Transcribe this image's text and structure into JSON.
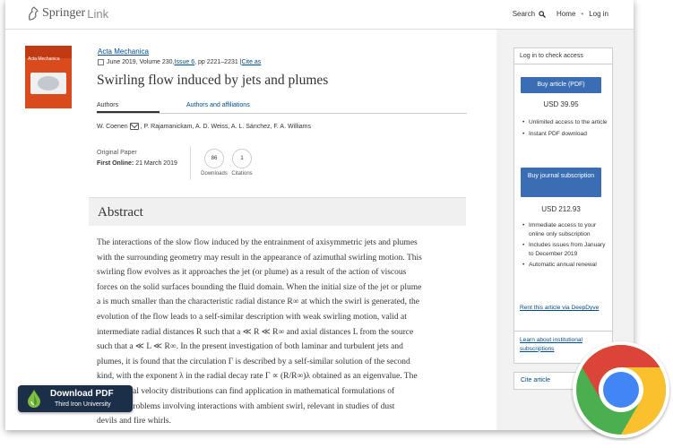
{
  "header": {
    "brand": "Springer",
    "brand_suffix": "Link",
    "search_label": "Search",
    "home_label": "Home",
    "separator": "•",
    "login_label": "Log in"
  },
  "cover": {
    "title": "Acta Mechanica"
  },
  "article": {
    "journal": "Acta Mechanica",
    "pub_date": "June 2019, Volume 230, ",
    "issue": "Issue 6",
    "pages": ", pp 2221–2231 | ",
    "cite_as": "Cite as",
    "title": "Swirling flow induced by jets and plumes",
    "tab_authors": "Authors",
    "tab_affiliations": "Authors and affiliations",
    "author_first": "W. Coenen",
    "authors_rest": ", P. Rajamanickam, A. D. Weiss, A. L. Sánchez, F. A. Williams",
    "paper_type": "Original Paper",
    "first_online_label": "First Online:",
    "first_online_date": "21 March 2019",
    "downloads_count": "86",
    "downloads_label": "Downloads",
    "citations_count": "1",
    "citations_label": "Citations"
  },
  "abstract": {
    "heading": "Abstract",
    "lines": [
      "The interactions of the slow flow induced by the entrainment of axisymmetric jets and plumes",
      "with the surrounding geometry may result in the appearance of azimuthal swirling motion. This",
      "swirling flow evolves as it approaches the jet (or plume) as a result of the action of viscous",
      "forces on the solid surfaces bounding the fluid domain. When the initial size of the jet or plume",
      "a is much smaller than the characteristic radial distance R∞ at which the swirl is generated, the",
      "evolution of the flow leads to a self-similar description with weak swirling motion, valid at",
      "intermediate radial distances R such that a ≪ R ≪ R∞ and axial distances L from the source",
      "such that a ≪ L ≪ R∞. In the present investigation of both laminar and turbulent jets and",
      "plumes, it is found that the circulation Γ is described by a self-similar solution of the second",
      "kind, with the exponent λ in the radial decay rate Γ ∝ (R/R∞)λ obtained as an eigenvalue. The",
      "... azimuthal velocity distributions can find application in mathematical formulations of",
      "... plume problems involving interactions with ambient swirl, relevant in studies of dust",
      "devils and fire whirls."
    ]
  },
  "sidebar": {
    "access_heading": "Log in to check access",
    "buy_article_label": "Buy article (PDF)",
    "article_price": "USD 39.95",
    "article_bullets": [
      "Unlimited access to the article",
      "Instant PDF download"
    ],
    "buy_journal_label": "Buy journal subscription",
    "journal_price": "USD 212.93",
    "journal_bullets": [
      "Immediate access to your online only subscription",
      "Includes issues from January to December 2019",
      "Automatic annual renewal"
    ],
    "rent_label": "Rent this article via DeepDyve",
    "institutional_label": "Learn about institutional subscriptions",
    "cite_article_label": "Cite article"
  },
  "download_badge": {
    "title": "Download PDF",
    "subtitle": "Third Iron University"
  },
  "icons": {
    "search": "search-icon",
    "mail": "mail-icon",
    "chrome": "chrome-logo-icon"
  },
  "colors": {
    "link": "#004b8d",
    "button": "#3b6db4",
    "badge": "#1c2f48",
    "cover": "#d94a1d"
  }
}
